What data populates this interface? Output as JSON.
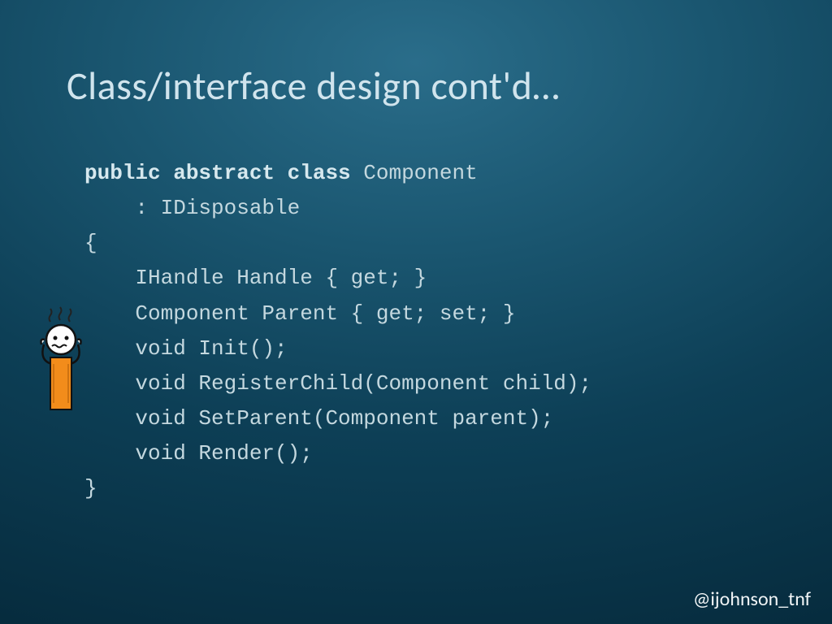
{
  "title": "Class/interface design cont'd…",
  "code": {
    "l0_kw": "public abstract class",
    "l0_rest": " Component",
    "l1": "    : IDisposable",
    "l2": "{",
    "l3": "    IHandle Handle { get; }",
    "l4": "    Component Parent { get; set; }",
    "l5": "    void Init();",
    "l6": "    void RegisterChild(Component child);",
    "l7": "    void SetParent(Component parent);",
    "l8": "    void Render();",
    "l9": "}"
  },
  "handle": "@ijohnson_tnf"
}
